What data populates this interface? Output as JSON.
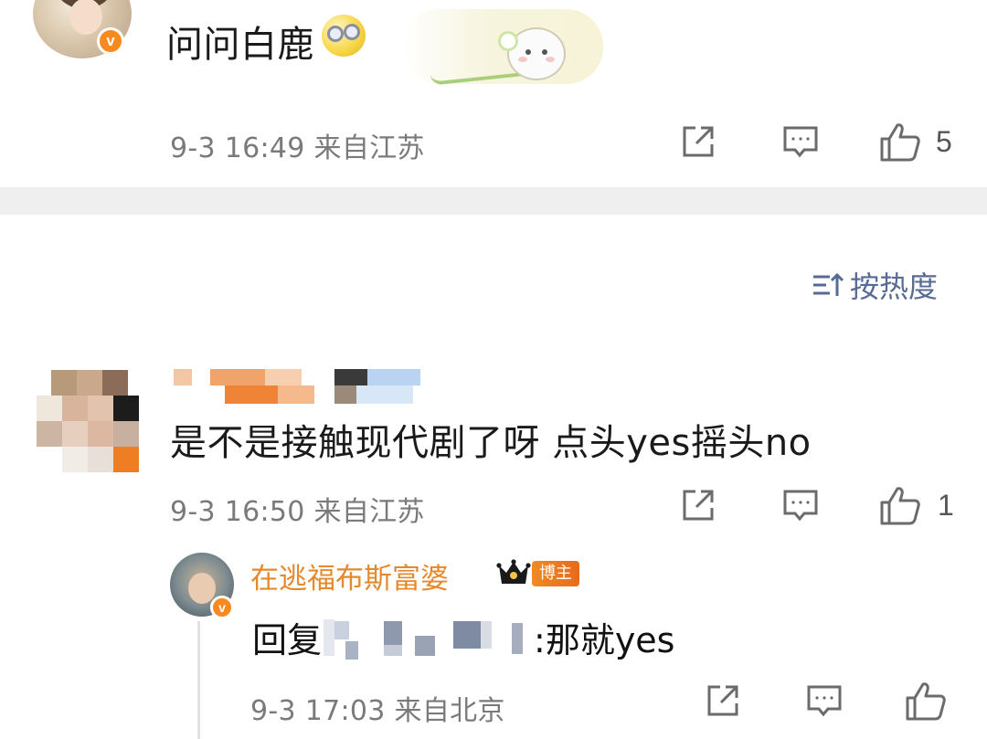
{
  "colors": {
    "text_primary": "#1a1a1a",
    "text_meta": "#7a7a7a",
    "link_blue": "#576b95",
    "username_orange": "#e58a2c",
    "verify_orange": "#f7891e",
    "divider_gray": "#efefef"
  },
  "comment1": {
    "text": "问问白鹿",
    "emoji_icon": "dizzy-face-emoji-icon",
    "sticker": "bunny-flower-sticker",
    "meta": "9-3 16:49 来自江苏",
    "actions": {
      "share_icon": "share-icon",
      "reply_icon": "comment-icon",
      "like_icon": "thumbs-up-icon",
      "like_count": "5"
    }
  },
  "sort": {
    "icon": "sort-icon",
    "label": "按热度"
  },
  "comment2": {
    "text": "是不是接触现代剧了呀 点头yes摇头no",
    "meta": "9-3 16:50 来自江苏",
    "actions": {
      "share_icon": "share-icon",
      "reply_icon": "comment-icon",
      "like_icon": "thumbs-up-icon",
      "like_count": "1"
    }
  },
  "reply": {
    "username": "在逃福布斯富婆",
    "badge": "博主",
    "crown_icon": "crown-icon",
    "text_prefix": "回复",
    "text_suffix": ":那就yes",
    "meta": "9-3 17:03 来自北京",
    "actions": {
      "share_icon": "share-icon",
      "reply_icon": "comment-icon",
      "like_icon": "thumbs-up-icon"
    }
  }
}
